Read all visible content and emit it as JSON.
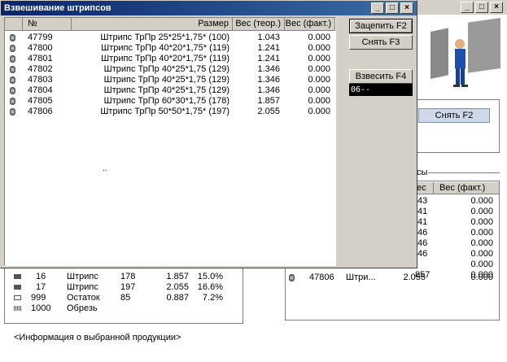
{
  "window": {
    "title": "Взвешивание штрипсов"
  },
  "columns": [
    "№",
    "Размер",
    "Вес (теор.)",
    "Вес (факт.)"
  ],
  "rows": [
    {
      "num": "47799",
      "size": "Штрипс ТрПр 25*25*1,75* (100)",
      "theor": "1.043",
      "fact": "0.000"
    },
    {
      "num": "47800",
      "size": "Штрипс ТрПр 40*20*1,75* (119)",
      "theor": "1.241",
      "fact": "0.000"
    },
    {
      "num": "47801",
      "size": "Штрипс ТрПр 40*20*1,75* (119)",
      "theor": "1.241",
      "fact": "0.000"
    },
    {
      "num": "47802",
      "size": "Штрипс ТрПр 40*25*1,75 (129)",
      "theor": "1.346",
      "fact": "0.000"
    },
    {
      "num": "47803",
      "size": "Штрипс ТрПр 40*25*1,75 (129)",
      "theor": "1.346",
      "fact": "0.000"
    },
    {
      "num": "47804",
      "size": "Штрипс ТрПр 40*25*1,75 (129)",
      "theor": "1.346",
      "fact": "0.000"
    },
    {
      "num": "47805",
      "size": "Штрипс ТрПр 60*30*1,75 (178)",
      "theor": "1.857",
      "fact": "0.000"
    },
    {
      "num": "47806",
      "size": "Штрипс ТрПр 50*50*1,75* (197)",
      "theor": "2.055",
      "fact": "0.000"
    }
  ],
  "table_ellipsis": "..",
  "buttons": {
    "hook": "Зацепить F2",
    "remove": "Снять F3",
    "weigh": "Взвесить F4",
    "bg_remove": "Снять F2"
  },
  "scale_display": "06--",
  "bg_left_rows": [
    {
      "n": "16",
      "type": "Штрипс",
      "len": "178",
      "w": "1.857",
      "p": "15.0%"
    },
    {
      "n": "17",
      "type": "Штрипс",
      "len": "197",
      "w": "2.055",
      "p": "16.6%"
    },
    {
      "n": "999",
      "type": "Остаток",
      "len": "85",
      "w": "0.887",
      "p": "7.2%"
    },
    {
      "n": "1000",
      "type": "Обрезь",
      "len": "",
      "w": "",
      "p": ""
    }
  ],
  "bg_right": {
    "header_ves": "ес",
    "header_fact": "Вес (факт.)",
    "label_fragment": "сы",
    "values": [
      "43",
      "41",
      "41",
      "46",
      "46",
      "46"
    ],
    "fact_values": [
      "0.000",
      "0.000",
      "0.000",
      "0.000",
      "0.000",
      "0.000",
      "0.000",
      "0.000"
    ],
    "row_partial": "857",
    "last_row": {
      "num": "47806",
      "name": "Штри...",
      "w": "2.055",
      "fact": "0.000"
    }
  },
  "info_text": "<Информация о выбранной продукции>"
}
